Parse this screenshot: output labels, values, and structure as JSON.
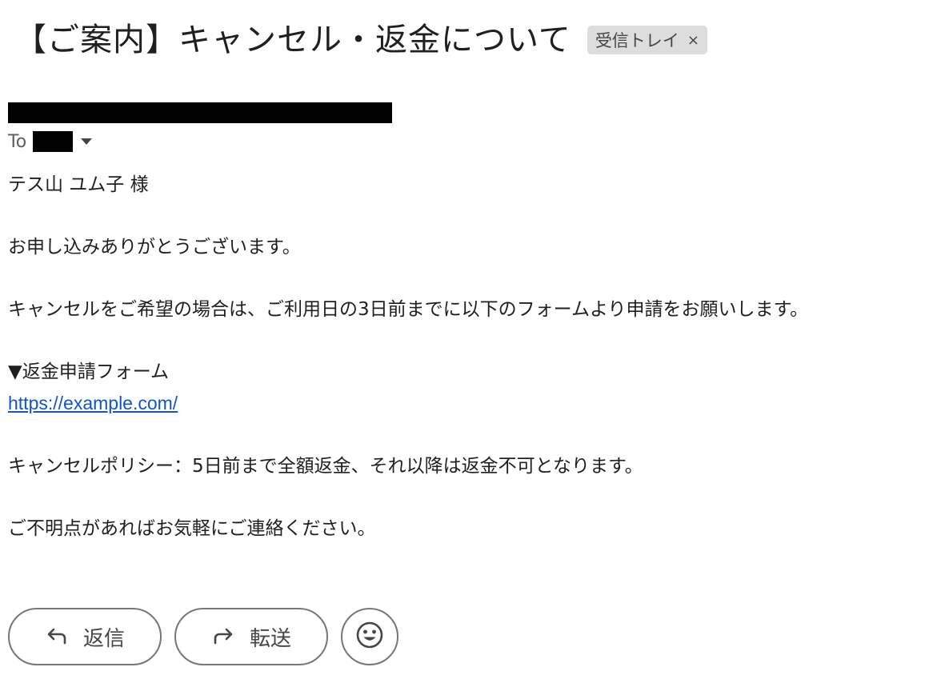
{
  "message": {
    "subject": "【ご案内】キャンセル・返金について",
    "label": "受信トレイ",
    "label_close": "×",
    "to_prefix": "To"
  },
  "body": {
    "greeting": "テス山 ユム子 様",
    "thanks": "お申し込みありがとうございます。",
    "instruction": "キャンセルをご希望の場合は、ご利用日の3日前までに以下のフォームより申請をお願いします。",
    "form_heading": "▼返金申請フォーム",
    "form_link": "https://example.com/",
    "policy": "キャンセルポリシー：5日前まで全額返金、それ以降は返金不可となります。",
    "closing": "ご不明点があればお気軽にご連絡ください。"
  },
  "actions": {
    "reply_label": "返信",
    "forward_label": "転送",
    "reply_icon": "reply-arrow-icon",
    "forward_icon": "forward-arrow-icon",
    "emoji_icon": "smiley-face-icon"
  },
  "colors": {
    "link": "#1155cc",
    "chip_background": "#dddddd",
    "button_border": "#747775"
  }
}
